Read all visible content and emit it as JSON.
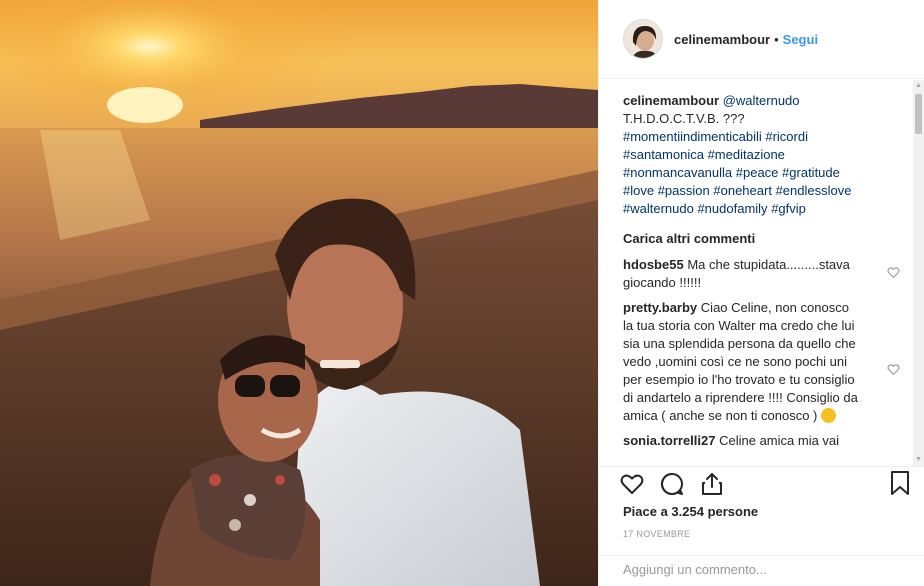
{
  "post": {
    "username": "celinemambour",
    "separator": "•",
    "follow_label": "Segui"
  },
  "caption": {
    "username": "celinemambour",
    "mention": "@walternudo",
    "text": "T.H.D.O.C.T.V.B. ???",
    "hashtags": [
      "#momentiindimenticabili",
      "#ricordi",
      "#santamonica",
      "#meditazione",
      "#nonmancavanulla",
      "#peace",
      "#gratitude",
      "#love",
      "#passion",
      "#oneheart",
      "#endlesslove",
      "#walternudo",
      "#nudofamily",
      "#gfvip"
    ]
  },
  "load_more_label": "Carica altri commenti",
  "comments": [
    {
      "username": "hdosbe55",
      "text": "Ma che stupidata.........stava giocando !!!!!!"
    },
    {
      "username": "pretty.barby",
      "text": "Ciao Celine, non conosco la tua storia con Walter ma credo che lui sia una splendida persona da quello che vedo ,uomini così ce ne sono pochi uni per esempio io l'ho trovato e tu consiglio di andartelo a riprendere !!!! Consiglio da amica ( anche se non ti conosco )"
    },
    {
      "username": "sonia.torrelli27",
      "text": "Celine amica mia vai"
    }
  ],
  "icons": {
    "like": "heart-icon",
    "comment": "comment-bubble-icon",
    "share": "share-icon",
    "save": "bookmark-icon",
    "comment_like": "small-heart-icon",
    "emoji": "face-blowing-kiss-emoji"
  },
  "likes_text": "Piace a 3.254 persone",
  "date_text": "17 NOVEMBRE",
  "add_comment_placeholder": "Aggiungi un commento...",
  "colors": {
    "link": "#3897f0",
    "hashtag": "#003569",
    "muted": "#999999",
    "text": "#262626"
  }
}
